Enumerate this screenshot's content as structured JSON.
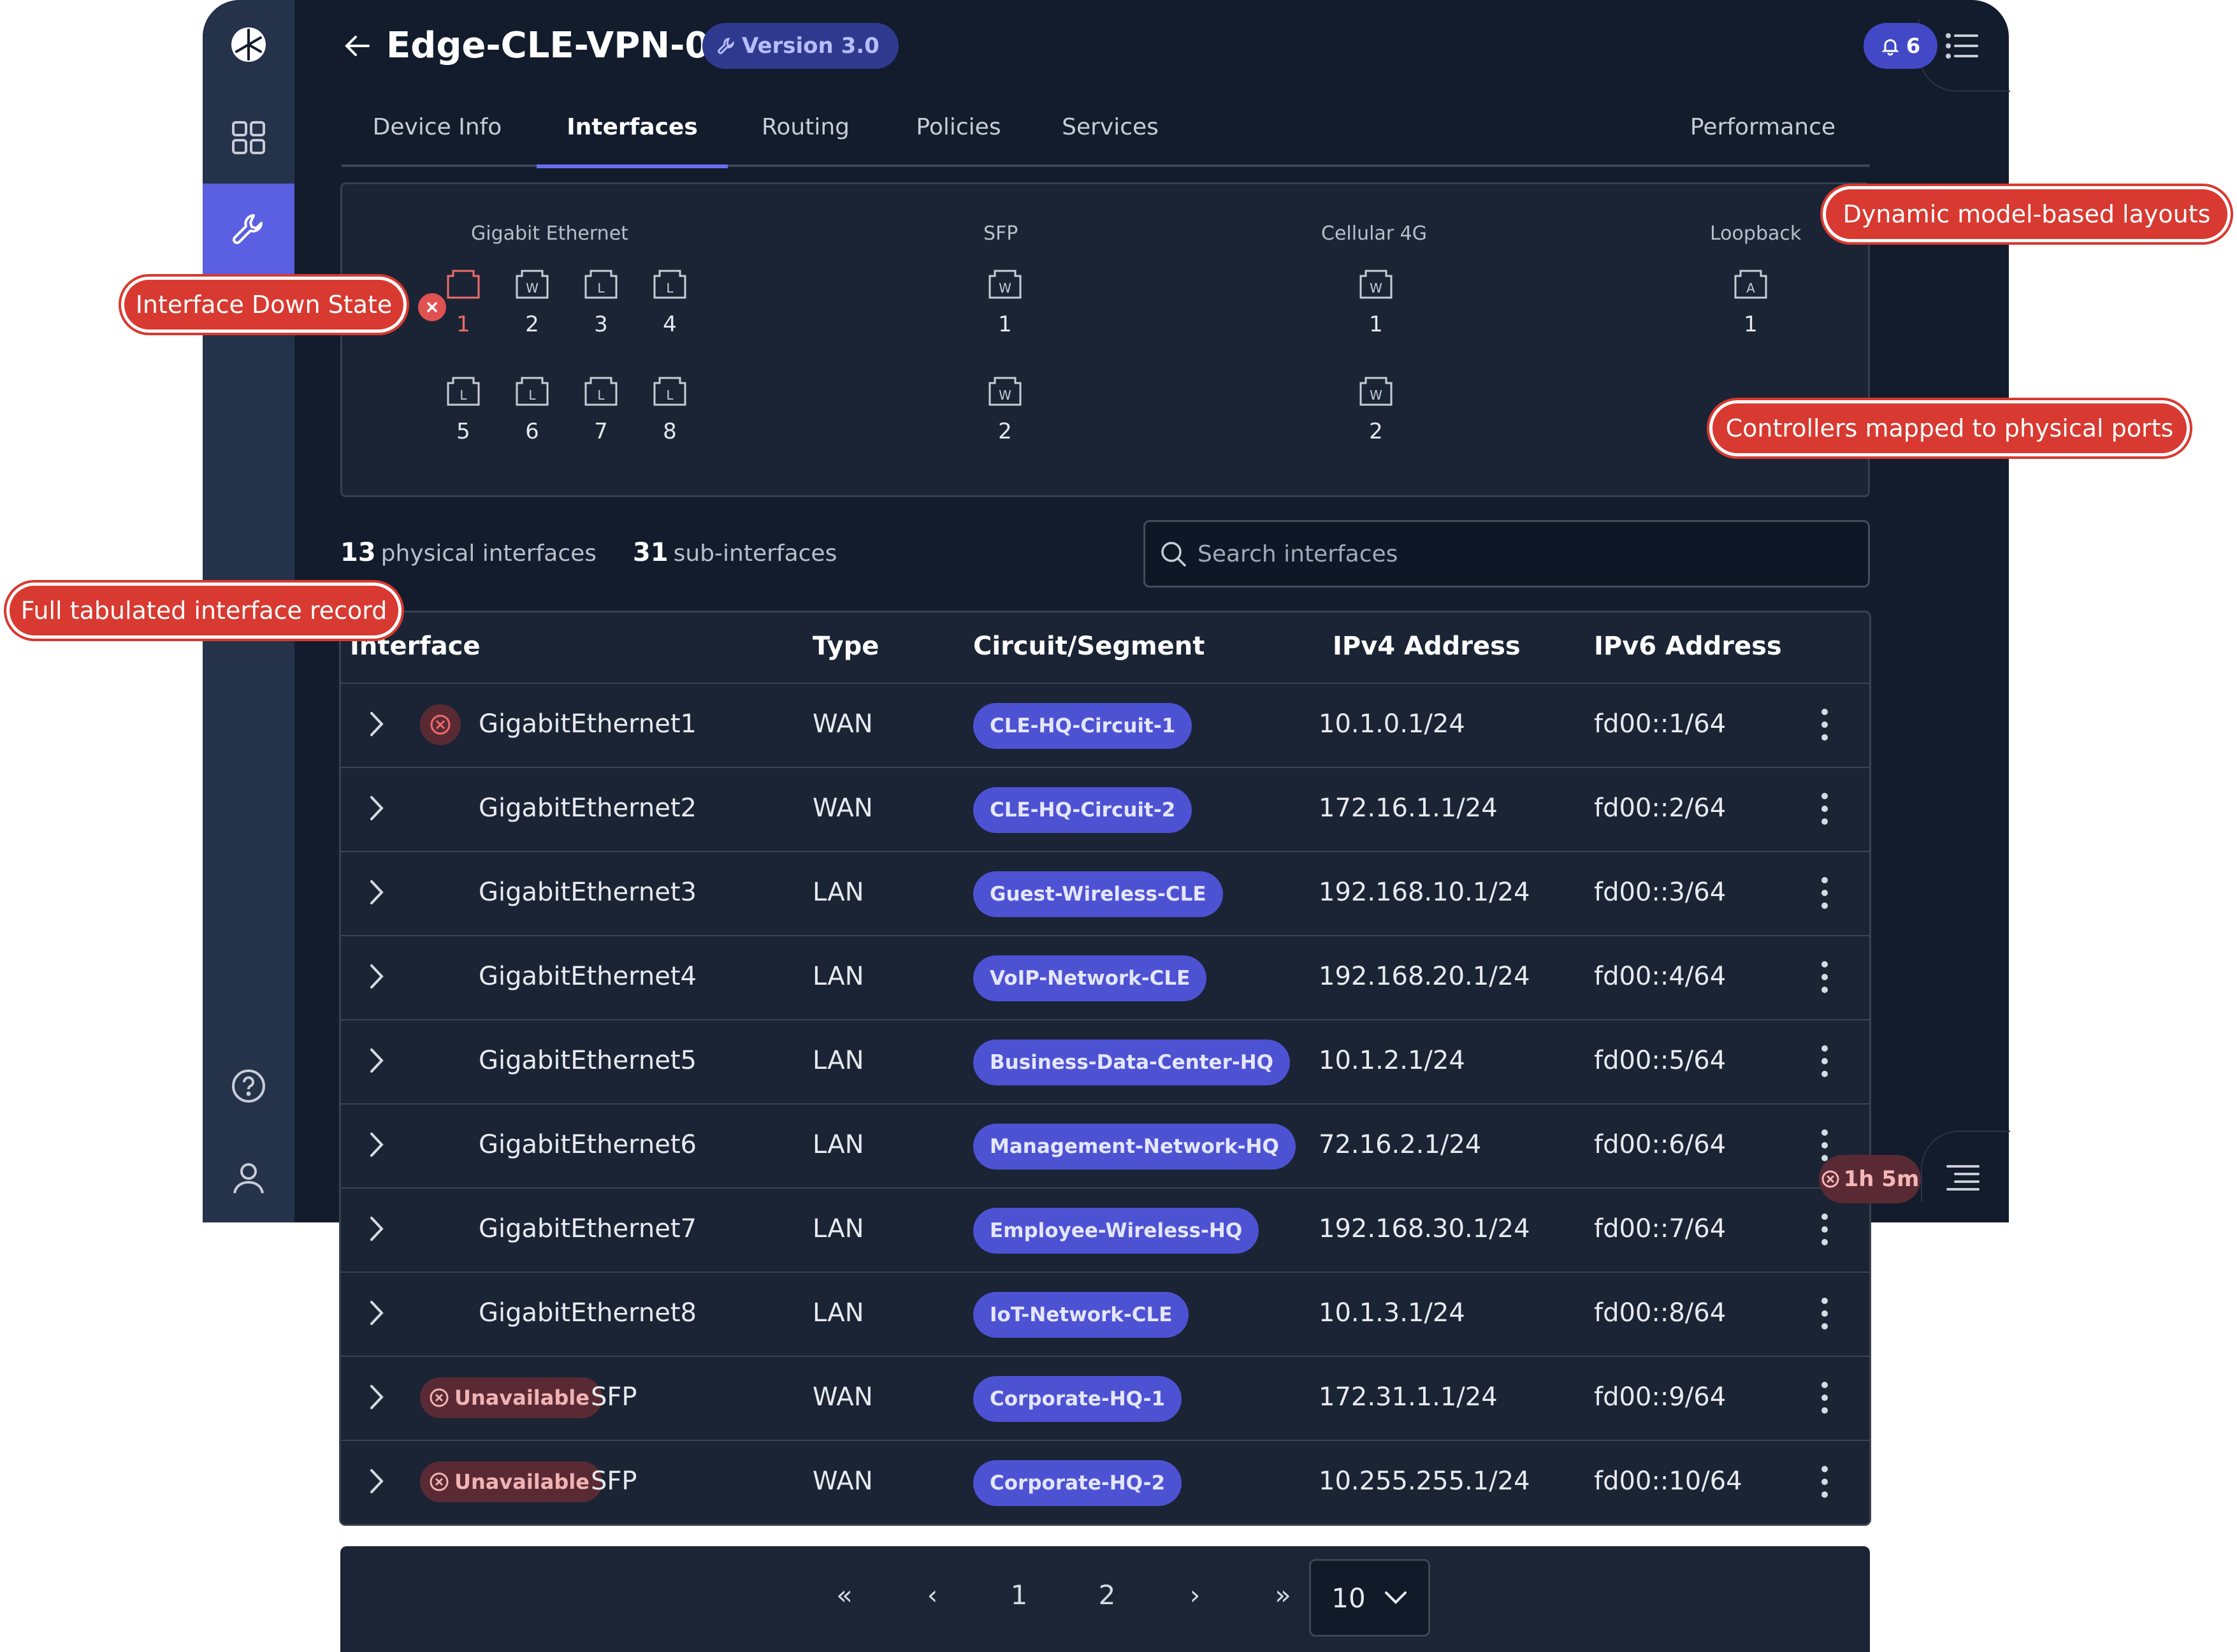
{
  "header": {
    "title": "Edge-CLE-VPN-02",
    "version": "Version 3.0",
    "notification_count": "6"
  },
  "tabs": [
    {
      "label": "Device Info"
    },
    {
      "label": "Interfaces",
      "active": true
    },
    {
      "label": "Routing"
    },
    {
      "label": "Policies"
    },
    {
      "label": "Services"
    },
    {
      "label": "Performance"
    }
  ],
  "port_groups": [
    {
      "label": "Gigabit Ethernet",
      "ports": [
        {
          "num": "1",
          "letter": "",
          "down": true
        },
        {
          "num": "2",
          "letter": "W"
        },
        {
          "num": "3",
          "letter": "L"
        },
        {
          "num": "4",
          "letter": "L"
        },
        {
          "num": "5",
          "letter": "L"
        },
        {
          "num": "6",
          "letter": "L"
        },
        {
          "num": "7",
          "letter": "L"
        },
        {
          "num": "8",
          "letter": "L"
        }
      ]
    },
    {
      "label": "SFP",
      "ports": [
        {
          "num": "1",
          "letter": "W"
        },
        {
          "num": "2",
          "letter": "W"
        }
      ]
    },
    {
      "label": "Cellular 4G",
      "ports": [
        {
          "num": "1",
          "letter": "W"
        },
        {
          "num": "2",
          "letter": "W"
        }
      ]
    },
    {
      "label": "Loopback",
      "ports": [
        {
          "num": "1",
          "letter": "A"
        }
      ]
    }
  ],
  "summary": {
    "physical_count": "13",
    "physical_label": "physical interfaces",
    "sub_count": "31",
    "sub_label": "sub-interfaces"
  },
  "search": {
    "placeholder": "Search interfaces"
  },
  "table": {
    "columns": [
      "Interface",
      "Type",
      "Circuit/Segment",
      "IPv4 Address",
      "IPv6 Address"
    ],
    "rows": [
      {
        "name": "GigabitEthernet1",
        "type": "WAN",
        "segment": "CLE-HQ-Circuit-1",
        "ipv4": "10.1.0.1/24",
        "ipv6": "fd00::1/64",
        "status": "down"
      },
      {
        "name": "GigabitEthernet2",
        "type": "WAN",
        "segment": "CLE-HQ-Circuit-2",
        "ipv4": "172.16.1.1/24",
        "ipv6": "fd00::2/64"
      },
      {
        "name": "GigabitEthernet3",
        "type": "LAN",
        "segment": "Guest-Wireless-CLE",
        "ipv4": "192.168.10.1/24",
        "ipv6": "fd00::3/64"
      },
      {
        "name": "GigabitEthernet4",
        "type": "LAN",
        "segment": "VoIP-Network-CLE",
        "ipv4": "192.168.20.1/24",
        "ipv6": "fd00::4/64"
      },
      {
        "name": "GigabitEthernet5",
        "type": "LAN",
        "segment": "Business-Data-Center-HQ",
        "ipv4": "10.1.2.1/24",
        "ipv6": "fd00::5/64"
      },
      {
        "name": "GigabitEthernet6",
        "type": "LAN",
        "segment": "Management-Network-HQ",
        "ipv4": "72.16.2.1/24",
        "ipv6": "fd00::6/64"
      },
      {
        "name": "GigabitEthernet7",
        "type": "LAN",
        "segment": "Employee-Wireless-HQ",
        "ipv4": "192.168.30.1/24",
        "ipv6": "fd00::7/64"
      },
      {
        "name": "GigabitEthernet8",
        "type": "LAN",
        "segment": "IoT-Network-CLE",
        "ipv4": "10.1.3.1/24",
        "ipv6": "fd00::8/64"
      },
      {
        "name": "SFP",
        "type": "WAN",
        "segment": "Corporate-HQ-1",
        "ipv4": "172.31.1.1/24",
        "ipv6": "fd00::9/64",
        "badge": "Unavailable"
      },
      {
        "name": "SFP",
        "type": "WAN",
        "segment": "Corporate-HQ-2",
        "ipv4": "10.255.255.1/24",
        "ipv6": "fd00::10/64",
        "badge": "Unavailable"
      }
    ]
  },
  "pagination": {
    "pages": [
      "1",
      "2"
    ],
    "page_size": "10"
  },
  "timer": "1h 5m",
  "callouts": {
    "dynamic": "Dynamic model-based layouts",
    "down_state": "Interface Down State",
    "controllers": "Controllers mapped to physical ports",
    "tabulated": "Full tabulated interface record"
  },
  "colors": {
    "background": "#121c2c",
    "accent": "#5b5fe1",
    "segment_pill": "#4d52d3",
    "callout": "#d83930",
    "down": "#e05252"
  }
}
